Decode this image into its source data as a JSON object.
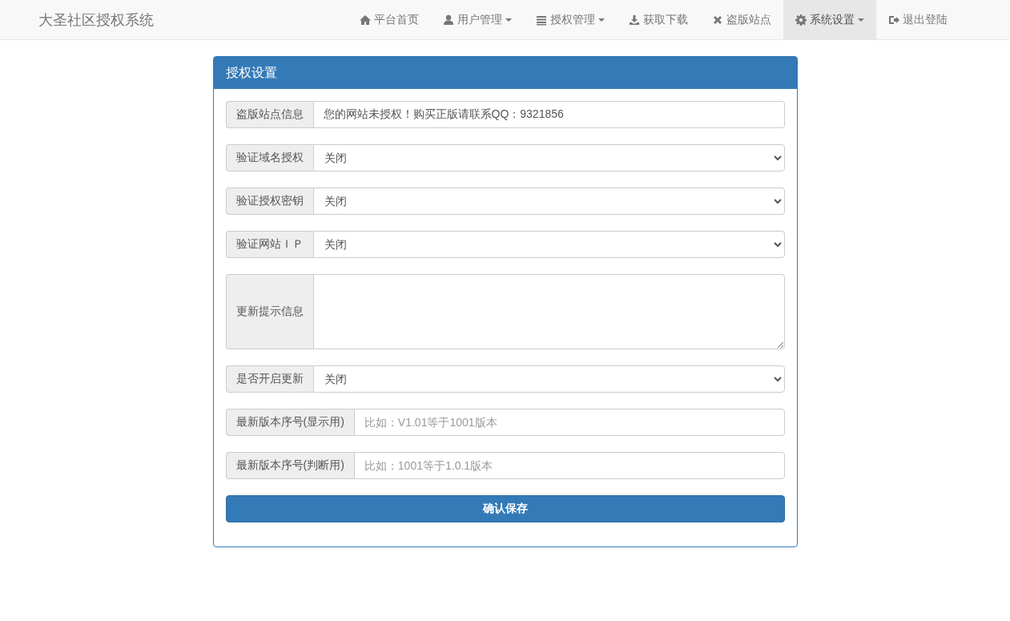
{
  "navbar": {
    "brand": "大圣社区授权系统",
    "items": [
      {
        "label": "平台首页",
        "caret": false,
        "selected": false
      },
      {
        "label": "用户管理",
        "caret": true,
        "selected": false
      },
      {
        "label": "授权管理",
        "caret": true,
        "selected": false
      },
      {
        "label": "获取下载",
        "caret": false,
        "selected": false
      },
      {
        "label": "盗版站点",
        "caret": false,
        "selected": false
      },
      {
        "label": "系统设置",
        "caret": true,
        "selected": true
      },
      {
        "label": "退出登陆",
        "caret": false,
        "selected": false
      }
    ]
  },
  "panel": {
    "title": "授权设置",
    "fields": [
      {
        "kind": "text",
        "label": "盗版站点信息",
        "value": "您的网站未授权！购买正版请联系QQ：9321856"
      },
      {
        "kind": "select",
        "label": "验证域名授权",
        "value": "关闭"
      },
      {
        "kind": "select",
        "label": "验证授权密钥",
        "value": "关闭"
      },
      {
        "kind": "select",
        "label": "验证网站ＩＰ",
        "value": "关闭"
      },
      {
        "kind": "textarea",
        "label": "更新提示信息"
      },
      {
        "kind": "select",
        "label": "是否开启更新",
        "value": "关闭"
      },
      {
        "kind": "text",
        "label": "最新版本序号(显示用)",
        "placeholder": "比如：V1.01等于1001版本"
      },
      {
        "kind": "text",
        "label": "最新版本序号(判断用)",
        "placeholder": "比如：1001等于1.0.1版本"
      }
    ],
    "submit": "确认保存"
  }
}
